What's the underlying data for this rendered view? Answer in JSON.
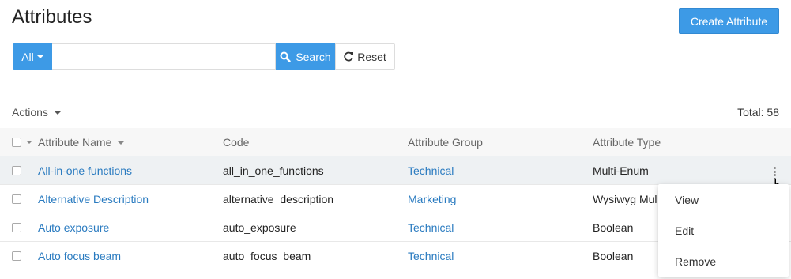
{
  "header": {
    "title": "Attributes",
    "create_label": "Create Attribute"
  },
  "search": {
    "filter_label": "All",
    "value": "",
    "placeholder": "",
    "search_label": "Search",
    "reset_label": "Reset"
  },
  "toolbar": {
    "actions_label": "Actions",
    "total_label": "Total: 58"
  },
  "table": {
    "columns": [
      "Attribute Name",
      "Code",
      "Attribute Group",
      "Attribute Type"
    ],
    "rows": [
      {
        "name": "All-in-one functions",
        "code": "all_in_one_functions",
        "group": "Technical",
        "type": "Multi-Enum"
      },
      {
        "name": "Alternative Description",
        "code": "alternative_description",
        "group": "Marketing",
        "type": "Wysiwyg Mul"
      },
      {
        "name": "Auto exposure",
        "code": "auto_exposure",
        "group": "Technical",
        "type": "Boolean"
      },
      {
        "name": "Auto focus beam",
        "code": "auto_focus_beam",
        "group": "Technical",
        "type": "Boolean"
      }
    ]
  },
  "row_menu": {
    "items": [
      "View",
      "Edit",
      "Remove"
    ]
  },
  "colors": {
    "accent": "#3d9ae6",
    "link": "#2a7bc0",
    "hover_row": "#eef1f3"
  },
  "icons": {
    "search": "search-icon",
    "reset": "refresh-icon",
    "row_actions": "kebab-icon"
  }
}
